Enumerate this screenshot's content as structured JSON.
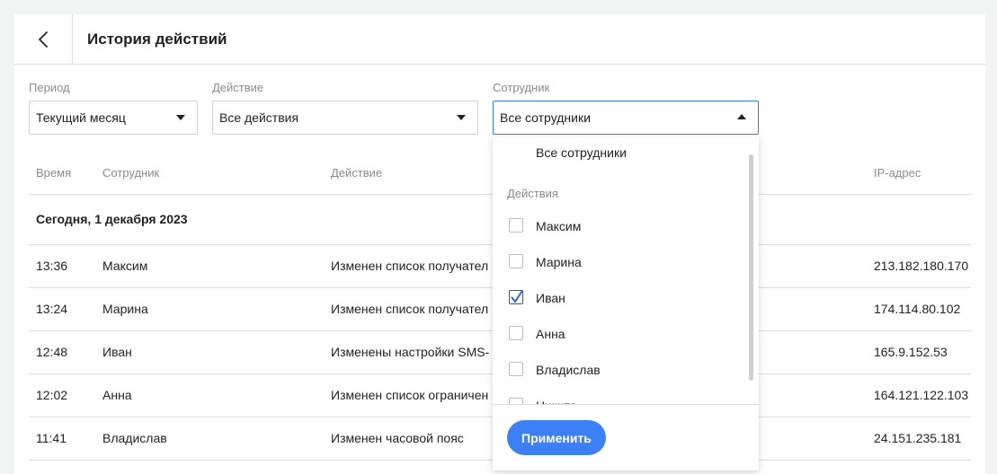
{
  "header": {
    "title": "История действий"
  },
  "filters": {
    "period": {
      "label": "Период",
      "value": "Текущий месяц"
    },
    "action": {
      "label": "Действие",
      "value": "Все действия"
    },
    "employee": {
      "label": "Сотрудник",
      "value": "Все сотрудники"
    }
  },
  "table": {
    "columns": [
      "Время",
      "Сотрудник",
      "Действие",
      "IP-адрес"
    ],
    "group_label": "Сегодня, 1 декабря 2023",
    "rows": [
      {
        "time": "13:36",
        "employee": "Максим",
        "action": "Изменен список получател",
        "ip": "213.182.180.170"
      },
      {
        "time": "13:24",
        "employee": "Марина",
        "action": "Изменен список получател",
        "ip": "174.114.80.102"
      },
      {
        "time": "12:48",
        "employee": "Иван",
        "action": "Изменены настройки SMS-",
        "ip": "165.9.152.53"
      },
      {
        "time": "12:02",
        "employee": "Анна",
        "action": "Изменен список ограничен",
        "ip": "164.121.122.103"
      },
      {
        "time": "11:41",
        "employee": "Владислав",
        "action": "Изменен часовой пояс",
        "ip": "24.151.235.181"
      }
    ]
  },
  "dropdown": {
    "all_option": "Все сотрудники",
    "section_label": "Действия",
    "items": [
      {
        "label": "Максим",
        "checked": false
      },
      {
        "label": "Марина",
        "checked": false
      },
      {
        "label": "Иван",
        "checked": true
      },
      {
        "label": "Анна",
        "checked": false
      },
      {
        "label": "Владислав",
        "checked": false
      },
      {
        "label": "Никита",
        "checked": false
      }
    ],
    "apply_label": "Применить"
  },
  "colors": {
    "accent": "#3d7ff4",
    "select_open_border": "#3a7bd5",
    "divider": "#dcdcdc",
    "muted_text": "#8a8a8a",
    "page_background": "#f2f3f3"
  },
  "icons": {
    "back": "chevron-left-icon",
    "caret_down": "caret-down-icon",
    "caret_up": "caret-up-icon",
    "check": "checkmark-icon"
  }
}
